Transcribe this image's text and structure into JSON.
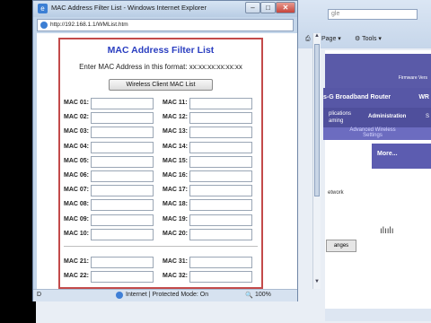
{
  "background": {
    "search_placeholder": "gle",
    "toolbar": {
      "page_label": "Page",
      "tools_label": "Tools"
    },
    "router_bar": "s-G Broadband Router",
    "router_bar_suffix": "WR",
    "firmware": "Firmware Vers",
    "nav": {
      "item1": "plications aming",
      "item2": "Administration",
      "item3": "S"
    },
    "nav2": {
      "item1": "Advanced Wireless Settings"
    },
    "more": "More...",
    "side_text": "etwork",
    "changes": "anges"
  },
  "popup": {
    "title": "MAC Address Filter List - Windows Internet Explorer",
    "url": "http://192.168.1.1/WMList.htm",
    "page": {
      "title": "MAC Address Filter List",
      "format_text": "Enter MAC Address in this format:  xx:xx:xx:xx:xx:xx",
      "wireless_button": "Wireless Client MAC List",
      "left_labels": [
        "MAC 01:",
        "MAC 02:",
        "MAC 03:",
        "MAC 04:",
        "MAC 05:",
        "MAC 06:",
        "MAC 07:",
        "MAC 08:",
        "MAC 09:",
        "MAC 10:"
      ],
      "right_labels": [
        "MAC 11:",
        "MAC 12:",
        "MAC 13:",
        "MAC 14:",
        "MAC 15:",
        "MAC 16:",
        "MAC 17:",
        "MAC 18:",
        "MAC 19:",
        "MAC 20:"
      ],
      "left_labels_2": [
        "MAC 21:",
        "MAC 22:"
      ],
      "right_labels_2": [
        "MAC 31:",
        "MAC 32:"
      ]
    },
    "status": {
      "left": "D",
      "zone": "Internet | Protected Mode: On",
      "zoom": "100%"
    }
  }
}
